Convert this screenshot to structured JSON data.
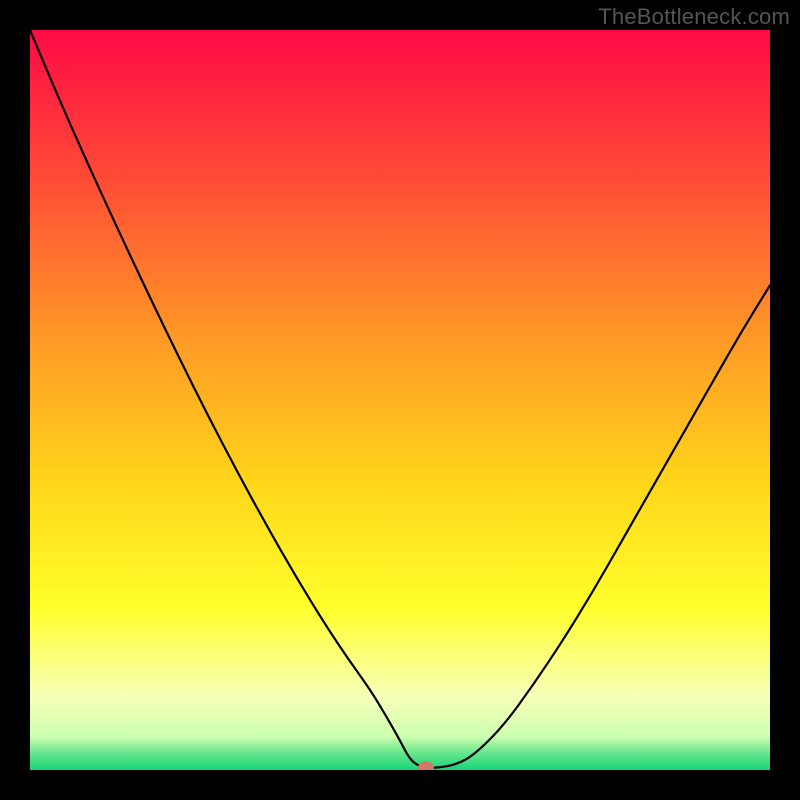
{
  "watermark": "TheBottleneck.com",
  "chart_data": {
    "type": "line",
    "title": "",
    "xlabel": "",
    "ylabel": "",
    "xlim": [
      0,
      1
    ],
    "ylim": [
      0,
      1
    ],
    "gradient": {
      "stops": [
        {
          "offset": 0.0,
          "color": "#ff0a45"
        },
        {
          "offset": 0.2,
          "color": "#ff4b36"
        },
        {
          "offset": 0.42,
          "color": "#ff9a26"
        },
        {
          "offset": 0.62,
          "color": "#ffd81a"
        },
        {
          "offset": 0.78,
          "color": "#ffff2b"
        },
        {
          "offset": 0.9,
          "color": "#f7ffb8"
        },
        {
          "offset": 0.955,
          "color": "#cdffb0"
        },
        {
          "offset": 0.975,
          "color": "#6fe88f"
        },
        {
          "offset": 1.0,
          "color": "#18d47a"
        }
      ]
    },
    "curve": {
      "x": [
        0.0,
        0.04,
        0.08,
        0.12,
        0.16,
        0.2,
        0.24,
        0.28,
        0.32,
        0.36,
        0.4,
        0.43,
        0.46,
        0.48,
        0.5,
        0.51,
        0.52,
        0.535,
        0.55,
        0.575,
        0.6,
        0.64,
        0.68,
        0.72,
        0.76,
        0.8,
        0.84,
        0.88,
        0.92,
        0.96,
        1.0
      ],
      "y": [
        1.0,
        0.905,
        0.815,
        0.728,
        0.643,
        0.56,
        0.48,
        0.403,
        0.33,
        0.26,
        0.195,
        0.15,
        0.108,
        0.075,
        0.04,
        0.02,
        0.008,
        0.003,
        0.003,
        0.007,
        0.02,
        0.06,
        0.115,
        0.175,
        0.24,
        0.31,
        0.38,
        0.45,
        0.52,
        0.59,
        0.655
      ]
    },
    "marker": {
      "x": 0.535,
      "y": 0.003,
      "color": "#d07a66"
    }
  }
}
